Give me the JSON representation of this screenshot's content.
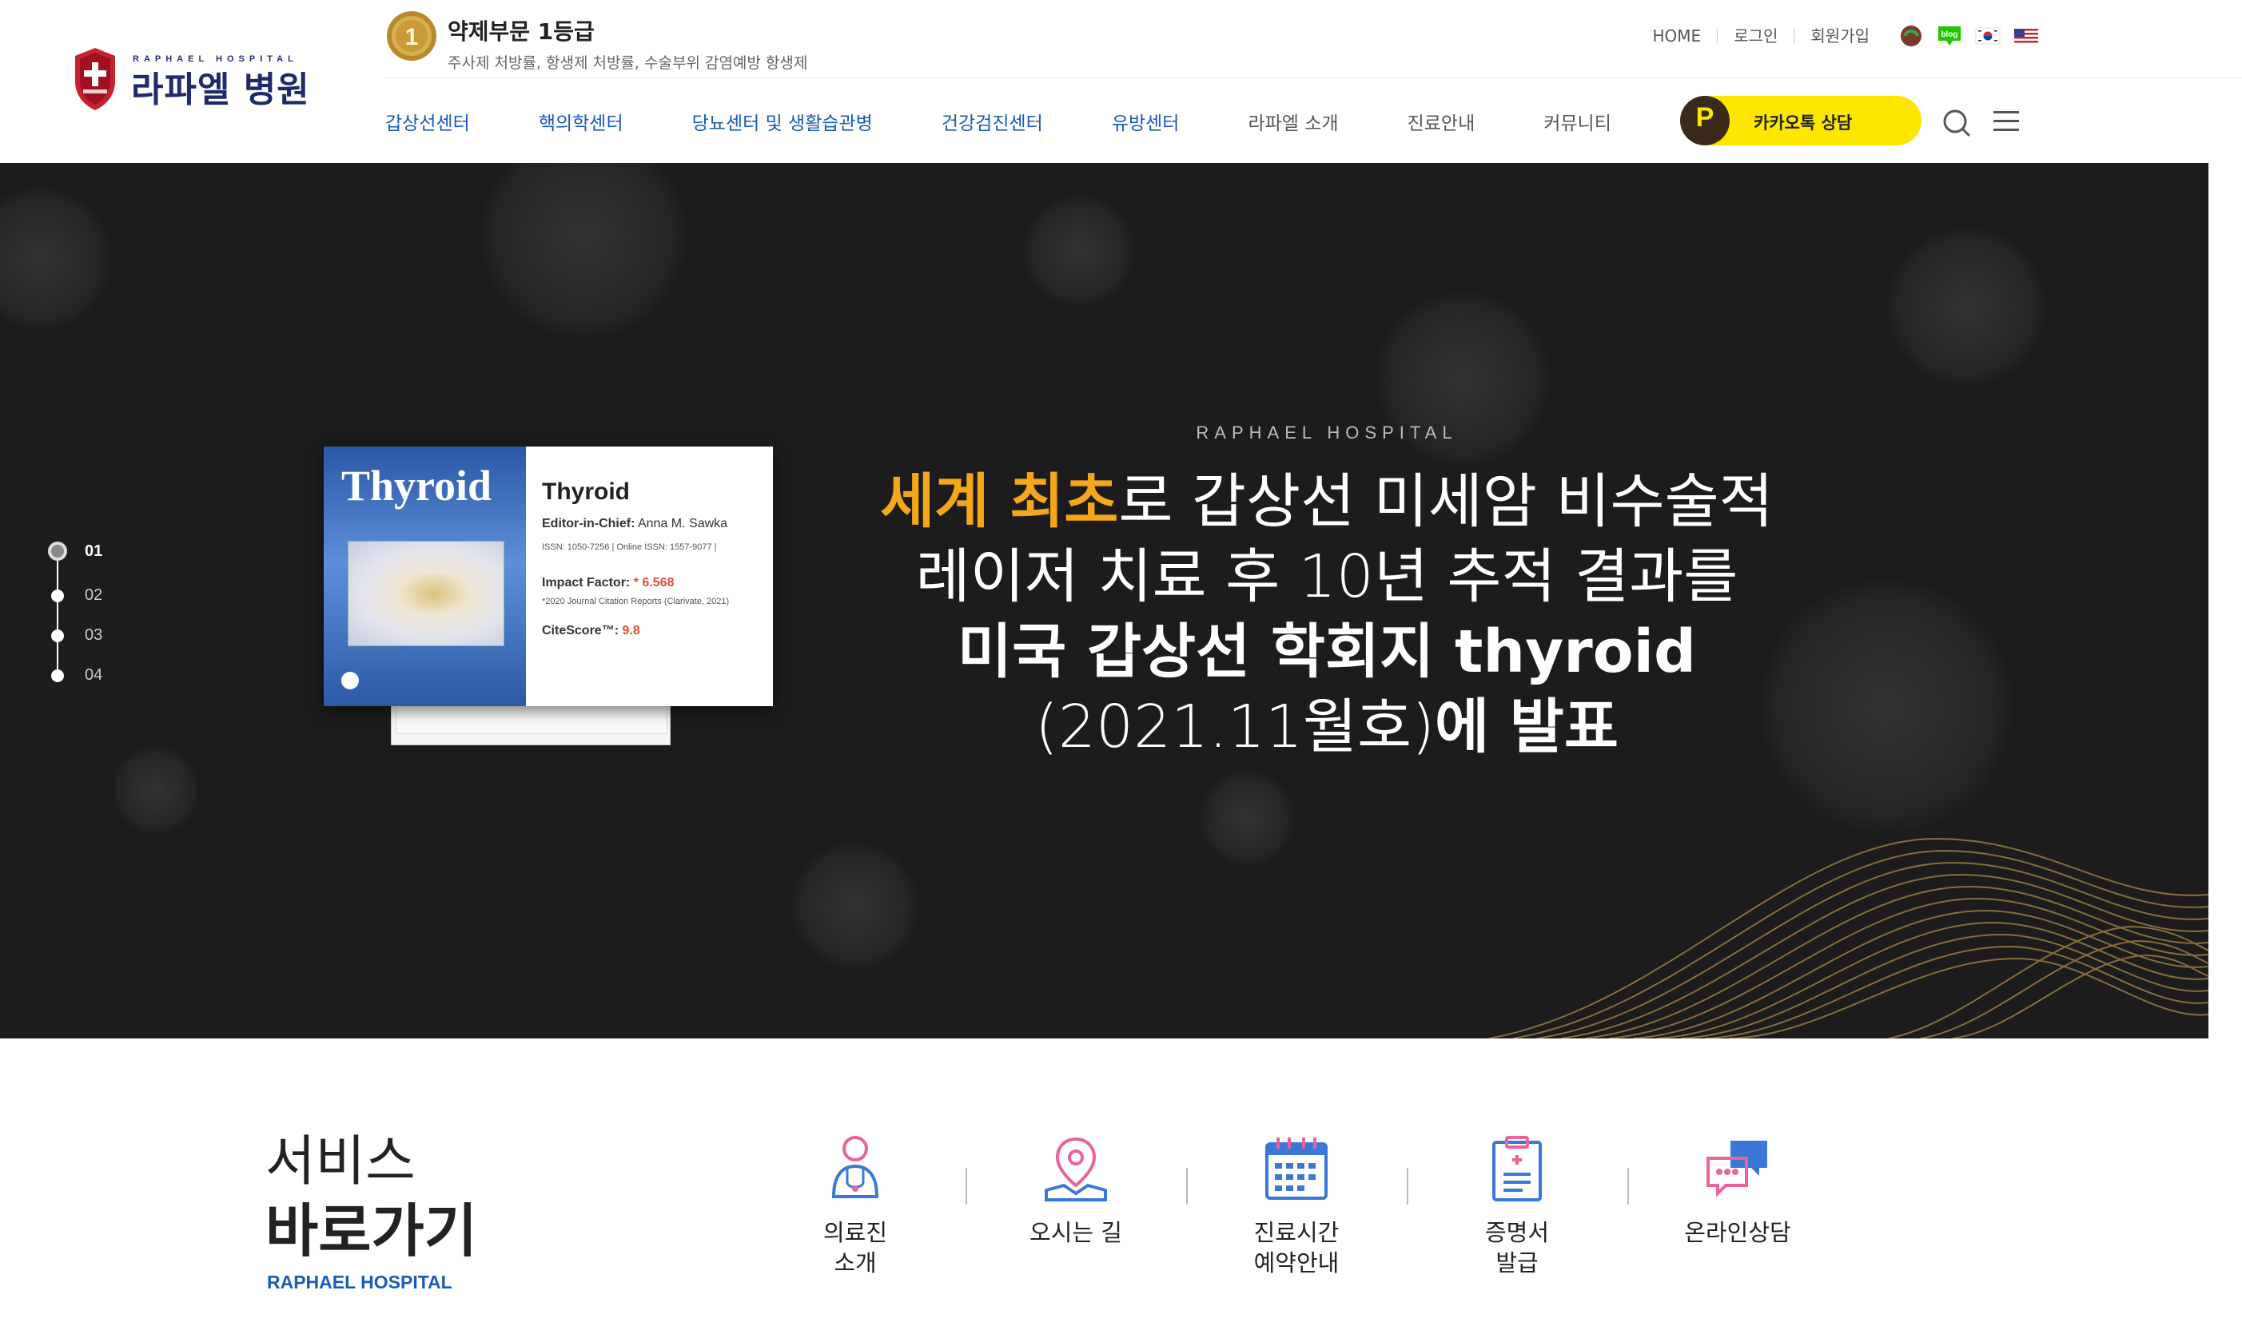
{
  "header": {
    "logo": {
      "sub": "RAPHAEL HOSPITAL",
      "name": "라파엘 병원"
    },
    "award": {
      "badge": "1",
      "title": "약제부문 1등급",
      "desc": "주사제 처방률, 항생제 처방률, 수술부위 감염예방 항생제"
    },
    "util": [
      {
        "label": "HOME"
      },
      {
        "label": "로그인"
      },
      {
        "label": "회원가입"
      }
    ],
    "util_icons": [
      "raphael-round-icon",
      "blog-icon",
      "korea-flag-icon",
      "usa-flag-icon"
    ],
    "blog_label": "blog",
    "gnb": [
      {
        "label": "갑상선센터",
        "accent": true
      },
      {
        "label": "핵의학센터",
        "accent": true
      },
      {
        "label": "당뇨센터 및 생활습관병",
        "accent": true
      },
      {
        "label": "건강검진센터",
        "accent": true
      },
      {
        "label": "유방센터",
        "accent": true
      },
      {
        "label": "라파엘 소개",
        "accent": false
      },
      {
        "label": "진료안내",
        "accent": false
      },
      {
        "label": "커뮤니티",
        "accent": false
      }
    ],
    "kakao": {
      "icon_letter": "P",
      "label": "카카오톡 상담"
    }
  },
  "hero": {
    "pager": [
      "01",
      "02",
      "03",
      "04"
    ],
    "active_slide": 0,
    "journal": {
      "cover_title": "Thyroid",
      "title": "Thyroid",
      "editor_label": "Editor-in-Chief:",
      "editor": "Anna M. Sawka",
      "issn": "ISSN: 1050-7256   |   Online ISSN: 1557-9077   |",
      "impact_label": "Impact Factor:",
      "impact_value": "* 6.568",
      "impact_note": "*2020 Journal Citation Reports (Clarivate, 2021)",
      "cite_label": "CiteScore™:",
      "cite_value": "9.8"
    },
    "eyebrow": "RAPHAEL HOSPITAL",
    "line1_gold": "세계 최초",
    "line1_rest": "로 갑상선 미세암 비수술적",
    "line2": "레이저 치료 후 10년 추적 결과를",
    "line3": "미국 갑상선 학회지 thyroid",
    "line4_light": "(2021.11월호)",
    "line4_bold": "에 발표"
  },
  "service": {
    "title_light": "서비스",
    "title_bold": "바로가기",
    "sub": "RAPHAEL HOSPITAL",
    "items": [
      {
        "label": "의료진\n소개",
        "icon": "doctor-icon"
      },
      {
        "label": "오시는 길",
        "icon": "location-pin-icon"
      },
      {
        "label": "진료시간\n예약안내",
        "icon": "calendar-icon"
      },
      {
        "label": "증명서\n발급",
        "icon": "clipboard-icon"
      },
      {
        "label": "온라인상담",
        "icon": "chat-icon"
      }
    ]
  },
  "colors": {
    "accent": "#1a5ab8",
    "gold": "#f6a61a",
    "kakao": "#fde600",
    "brand_navy": "#1f2a6b",
    "hero_bg": "#1c1c1c"
  }
}
